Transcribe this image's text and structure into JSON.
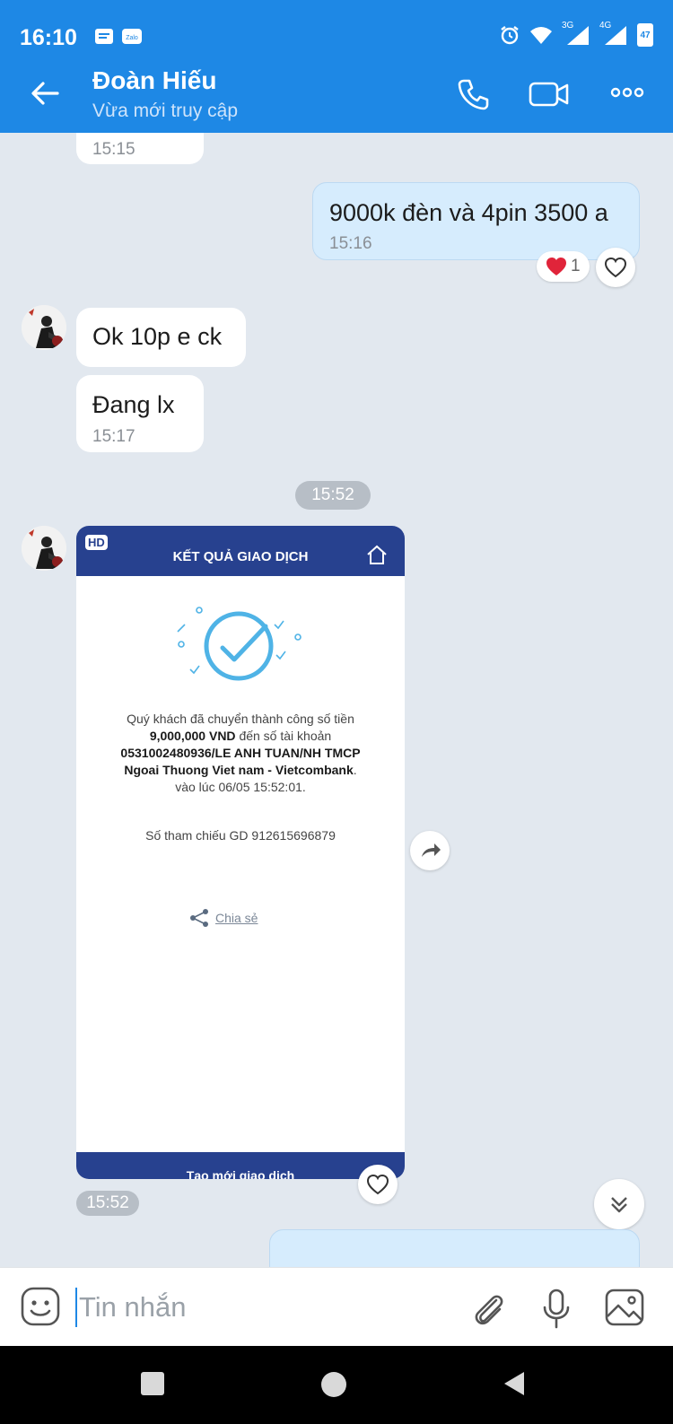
{
  "status_bar": {
    "time": "16:10",
    "net1": "3G",
    "net2": "4G",
    "battery": "47"
  },
  "header": {
    "contact_name": "Đoàn Hiếu",
    "contact_status": "Vừa mới truy cập"
  },
  "messages": {
    "m0": {
      "time": "15:15"
    },
    "m1": {
      "text": "9000k đèn và 4pin 3500 a",
      "time": "15:16",
      "reaction_count": "1"
    },
    "m2": {
      "text": "Ok 10p e ck"
    },
    "m3": {
      "text": "Đang lx",
      "time": "15:17"
    },
    "divider_time": "15:52",
    "receipt": {
      "hd_label": "HD",
      "title": "KẾT QUẢ GIAO DỊCH",
      "line1": "Quý khách đã chuyển thành công số tiền",
      "amount": "9,000,000 VND",
      "line2": "đến số tài khoản",
      "account": "0531002480936/LE ANH TUAN/NH TMCP",
      "bank": "Ngoai Thuong Viet nam - Vietcombank",
      "bank_suffix": ".",
      "timestamp": "vào lúc 06/05 15:52:01.",
      "reference": "Số tham chiếu GD 912615696879",
      "share": "Chia sẻ",
      "footer_text": "Tạo mới giao dịch",
      "time": "15:52"
    }
  },
  "composer": {
    "placeholder": "Tin nhắn"
  },
  "colors": {
    "header_blue": "#1e88e5",
    "receipt_blue": "#27418f",
    "check_cyan": "#4fb3e6",
    "heart_red": "#e0243a"
  }
}
